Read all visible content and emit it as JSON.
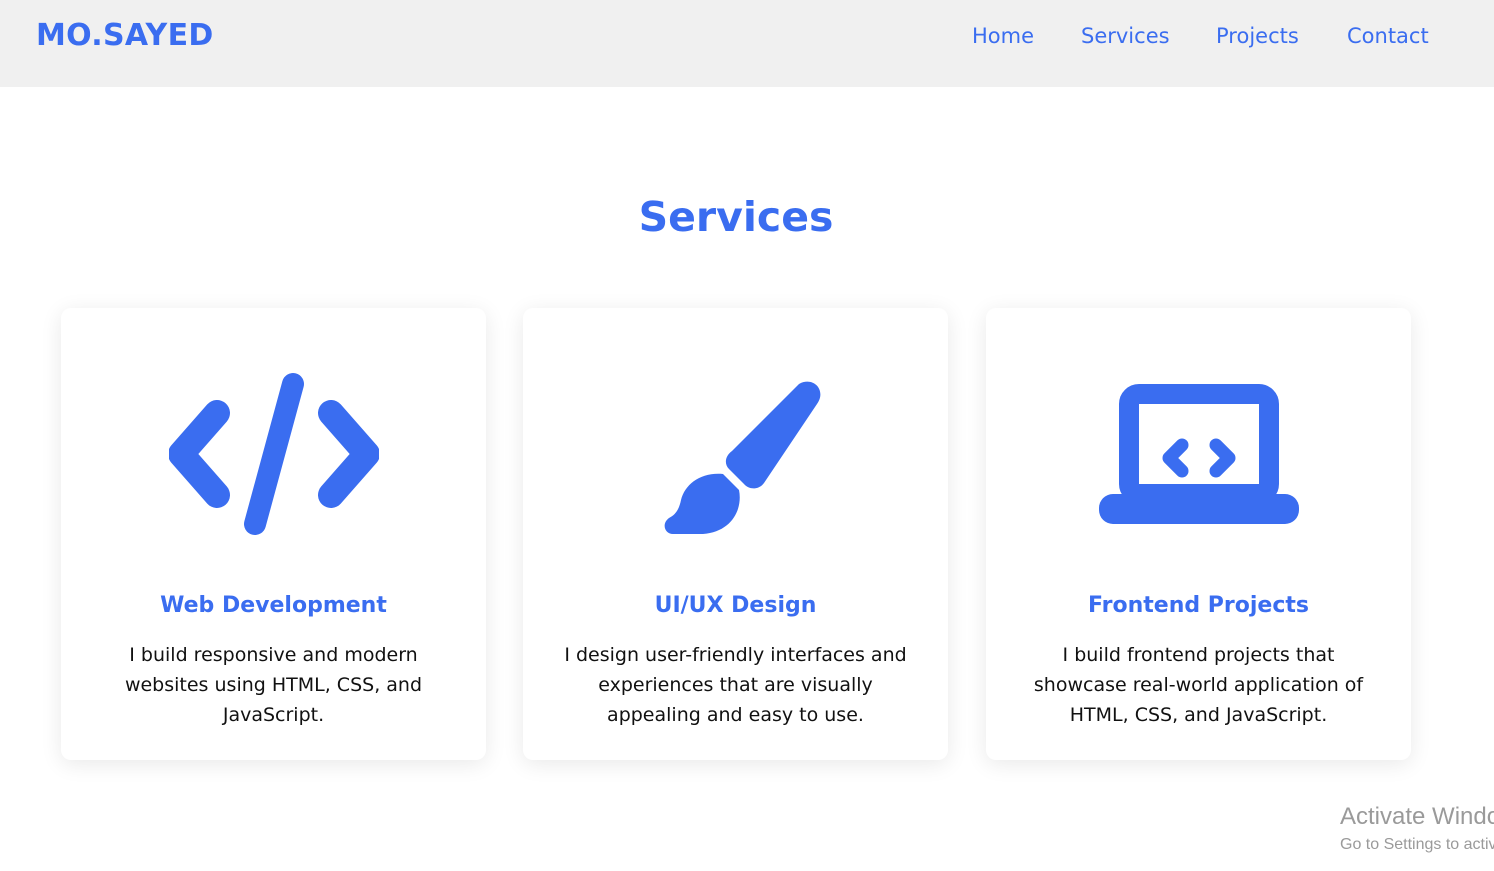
{
  "header": {
    "logo": "MO.SAYED",
    "nav": {
      "home": "Home",
      "services": "Services",
      "projects": "Projects",
      "contact": "Contact"
    }
  },
  "main": {
    "title": "Services",
    "cards": [
      {
        "icon": "code-icon",
        "title": "Web Development",
        "text": "I build responsive and modern websites using HTML, CSS, and JavaScript."
      },
      {
        "icon": "paintbrush-icon",
        "title": "UI/UX Design",
        "text": "I design user-friendly interfaces and experiences that are visually appealing and easy to use."
      },
      {
        "icon": "laptop-code-icon",
        "title": "Frontend Projects",
        "text": "I build frontend projects that showcase real-world application of HTML, CSS, and JavaScript."
      }
    ]
  },
  "watermark": {
    "title": "Activate Windows",
    "subtitle": "Go to Settings to activate Windows."
  },
  "colors": {
    "accent": "#3a6df0",
    "nav_bg": "#f0f0f0",
    "text": "#111111"
  }
}
